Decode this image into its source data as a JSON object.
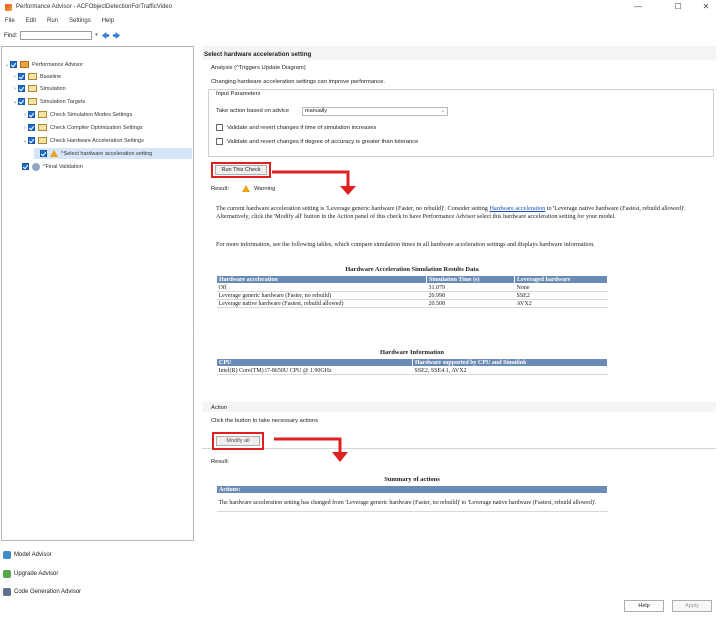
{
  "window": {
    "title": "Performance Advisor - ACFObjectDetectionForTrafficVideo",
    "minimize": "—",
    "maximize": "☐",
    "close": "✕"
  },
  "menu": [
    "File",
    "Edit",
    "Run",
    "Settings",
    "Help"
  ],
  "find": {
    "label": "Find:",
    "value": ""
  },
  "tree": {
    "root": "Performance Advisor",
    "baseline": "Baseline",
    "simulation": "Simulation",
    "targets": "Simulation Targets",
    "check_modes": "Check Simulation Modes Settings",
    "check_compiler": "Check Compiler Optimization Settings",
    "check_hw": "Check Hardware Acceleration Settings",
    "select_hw": "^Select hardware acceleration setting",
    "final": "^Final Validation"
  },
  "advisors": [
    "Model Advisor",
    "Upgrade Advisor",
    "Code Generation Advisor"
  ],
  "right": {
    "heading": "Select hardware acceleration setting",
    "analysis": "Analysis (^Triggers Update Diagram)",
    "description": "Changing hardware acceleration settings can improve performance.",
    "input_params": "Input Parameters",
    "advice_label": "Take action based on advice",
    "advice_value": "manually",
    "opt1": "Validate and revert changes if time of simulation increases",
    "opt2": "Validate and revert changes if degree of accuracy is greater than tolerance",
    "run_button": "Run This Check",
    "result_label": "Result:",
    "result_status": "Warning",
    "para1_a": "The current hardware acceleration setting is 'Leverage generic hardware (Faster, no rebuild)'. Consider setting ",
    "para1_link": "Hardware acceleration",
    "para1_b": " to 'Leverage native hardware (Fastest, rebuild allowed)'. Alternatively, click the 'Modify all' button in the Action panel of this check to have Performance Advisor select this hardware acceleration setting for your model.",
    "para2": "For more information, see the following tables, which compare simulation times in all hardware acceleration settings and displays hardware information.",
    "action_heading": "Action",
    "action_desc": "Click the button to take necessary actions",
    "modify_button": "Modify all",
    "result2_label": "Result:"
  },
  "sim_table": {
    "title": "Hardware Acceleration Simulation Results Data",
    "headers": [
      "Hardware acceleration",
      "Simulation Time (s)",
      "Leveraged hardware"
    ],
    "rows": [
      [
        "Off",
        "31.079",
        "None"
      ],
      [
        "Leverage generic hardware (Faster, no rebuild)",
        "20.998",
        "SSE2"
      ],
      [
        "Leverage native hardware (Fastest, rebuild allowed)",
        "20.508",
        "AVX2"
      ]
    ]
  },
  "hw_table": {
    "title": "Hardware Information",
    "headers": [
      "CPU",
      "Hardware supported by CPU and Simulink"
    ],
    "rows": [
      [
        "Intel(R) Core(TM) i7-8650U CPU @ 1.90GHz",
        "SSE2, SSE4.1, AVX2"
      ]
    ]
  },
  "summary": {
    "title": "Summary of actions",
    "header": "Actions:",
    "text": "The hardware acceleration setting has changed from 'Leverage generic hardware (Faster, no rebuild)' to 'Leverage native hardware (Fastest, rebuild allowed)'."
  },
  "footer": {
    "help": "Help",
    "apply": "Apply"
  },
  "colors": {
    "accent": "#1e6fd0",
    "highlight": "#e02020",
    "table_header": "#6a8bb5",
    "warning": "#e8a317"
  }
}
